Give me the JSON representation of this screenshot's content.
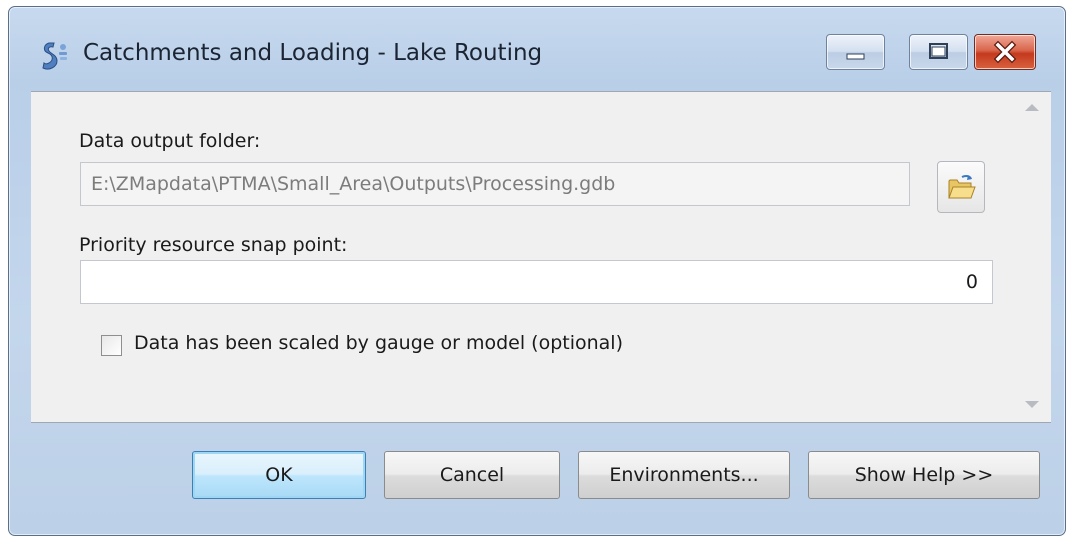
{
  "window": {
    "title": "Catchments and Loading - Lake Routing",
    "app_icon": "python-script-tool-icon",
    "controls": [
      "minimize-icon",
      "maximize-icon",
      "close-icon"
    ]
  },
  "form": {
    "output_folder": {
      "label": "Data output folder:",
      "value": "E:\\ZMapdata\\PTMA\\Small_Area\\Outputs\\Processing.gdb",
      "browse_icon": "open-folder-icon"
    },
    "snap_point": {
      "label": "Priority resource snap point:",
      "value": "0"
    },
    "scaled_checkbox": {
      "label": "Data has been scaled by gauge or model (optional)",
      "checked": false
    }
  },
  "buttons": {
    "ok": "OK",
    "cancel": "Cancel",
    "environments": "Environments...",
    "show_help": "Show Help >>"
  },
  "colors": {
    "frame": "#bcd0e7",
    "client_bg": "#f0f0f0",
    "close_button": "#c43a1e",
    "ok_button_border": "#3c7fb1"
  }
}
